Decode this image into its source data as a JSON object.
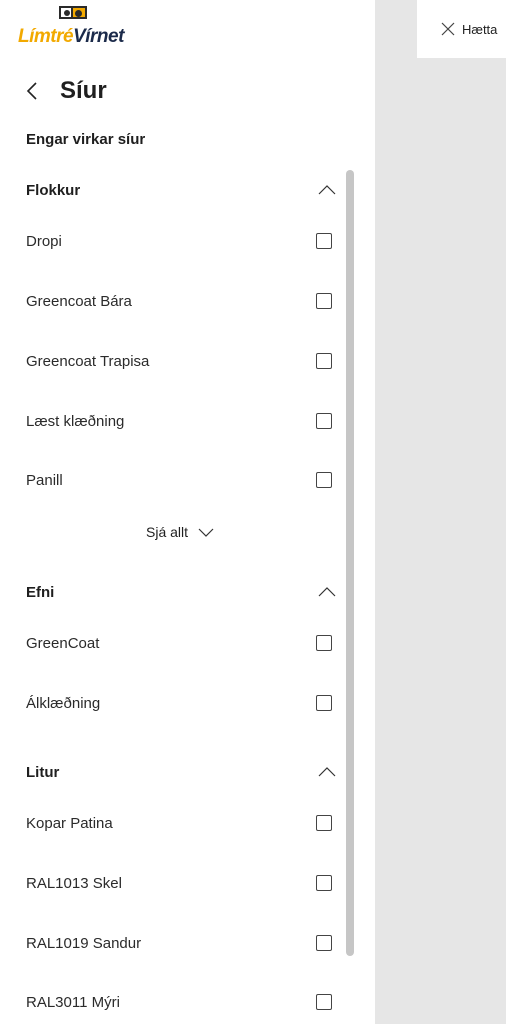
{
  "logo": {
    "part1": "Límtré",
    "part2": "Vírnet"
  },
  "header": {
    "title": "Síur"
  },
  "active_filters": "Engar virkar síur",
  "sections": [
    {
      "title": "Flokkur",
      "options": [
        "Dropi",
        "Greencoat Bára",
        "Greencoat Trapisa",
        "Læst klæðning",
        "Panill"
      ],
      "see_all": "Sjá allt"
    },
    {
      "title": "Efni",
      "options": [
        "GreenCoat",
        "Álklæðning"
      ]
    },
    {
      "title": "Litur",
      "options": [
        "Kopar Patina",
        "RAL1013 Skel",
        "RAL1019 Sandur",
        "RAL3011 Mýri"
      ]
    }
  ],
  "cancel": {
    "label": "Hætta"
  },
  "colors": {
    "brand_yellow": "#f2a900",
    "brand_navy": "#1b2a4a",
    "overlay": "#e6e6e6"
  },
  "icons": {
    "back": "chevron-left-icon",
    "collapse": "chevron-up-icon",
    "expand": "chevron-down-icon",
    "close": "close-icon"
  }
}
